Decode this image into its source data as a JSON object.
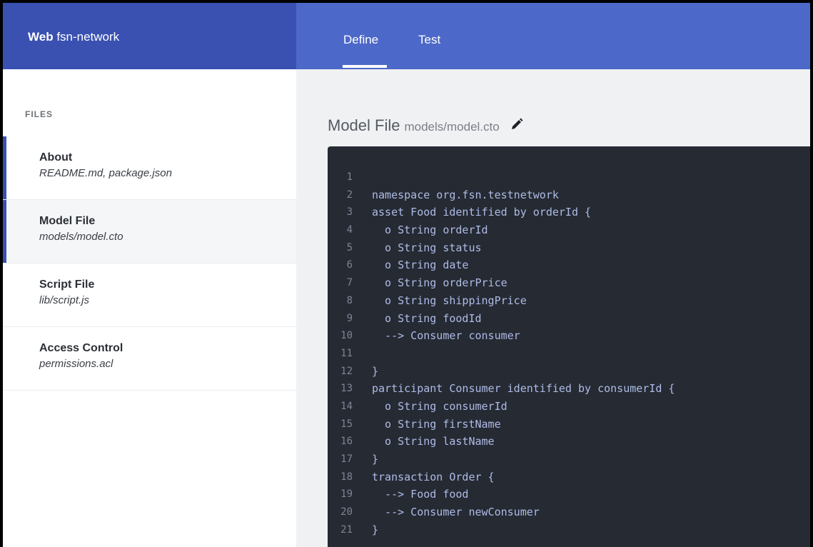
{
  "header": {
    "brand_bold": "Web",
    "brand_name": "fsn-network",
    "tabs": [
      {
        "label": "Define",
        "active": true
      },
      {
        "label": "Test",
        "active": false
      }
    ]
  },
  "sidebar": {
    "heading": "FILES",
    "items": [
      {
        "title": "About",
        "subtitle": "README.md, package.json",
        "selected": false
      },
      {
        "title": "Model File",
        "subtitle": "models/model.cto",
        "selected": true
      },
      {
        "title": "Script File",
        "subtitle": "lib/script.js",
        "selected": false
      },
      {
        "title": "Access Control",
        "subtitle": "permissions.acl",
        "selected": false
      }
    ]
  },
  "main": {
    "title": "Model File",
    "path": "models/model.cto",
    "edit_icon": "pencil-icon"
  },
  "editor": {
    "lines": [
      {
        "n": "1",
        "text": ""
      },
      {
        "n": "2",
        "text": "namespace org.fsn.testnetwork"
      },
      {
        "n": "3",
        "text": "asset Food identified by orderId {"
      },
      {
        "n": "4",
        "text": "  o String orderId"
      },
      {
        "n": "5",
        "text": "  o String status"
      },
      {
        "n": "6",
        "text": "  o String date"
      },
      {
        "n": "7",
        "text": "  o String orderPrice"
      },
      {
        "n": "8",
        "text": "  o String shippingPrice"
      },
      {
        "n": "9",
        "text": "  o String foodId"
      },
      {
        "n": "10",
        "text": "  --> Consumer consumer"
      },
      {
        "n": "11",
        "text": ""
      },
      {
        "n": "12",
        "text": "}"
      },
      {
        "n": "13",
        "text": "participant Consumer identified by consumerId {"
      },
      {
        "n": "14",
        "text": "  o String consumerId"
      },
      {
        "n": "15",
        "text": "  o String firstName"
      },
      {
        "n": "16",
        "text": "  o String lastName"
      },
      {
        "n": "17",
        "text": "}"
      },
      {
        "n": "18",
        "text": "transaction Order {"
      },
      {
        "n": "19",
        "text": "  --> Food food"
      },
      {
        "n": "20",
        "text": "  --> Consumer newConsumer"
      },
      {
        "n": "21",
        "text": "}"
      }
    ]
  },
  "colors": {
    "brand_bar": "#3a51b2",
    "nav_bar": "#4c68c9",
    "editor_bg": "#262a33",
    "code_text": "#aebce6"
  }
}
